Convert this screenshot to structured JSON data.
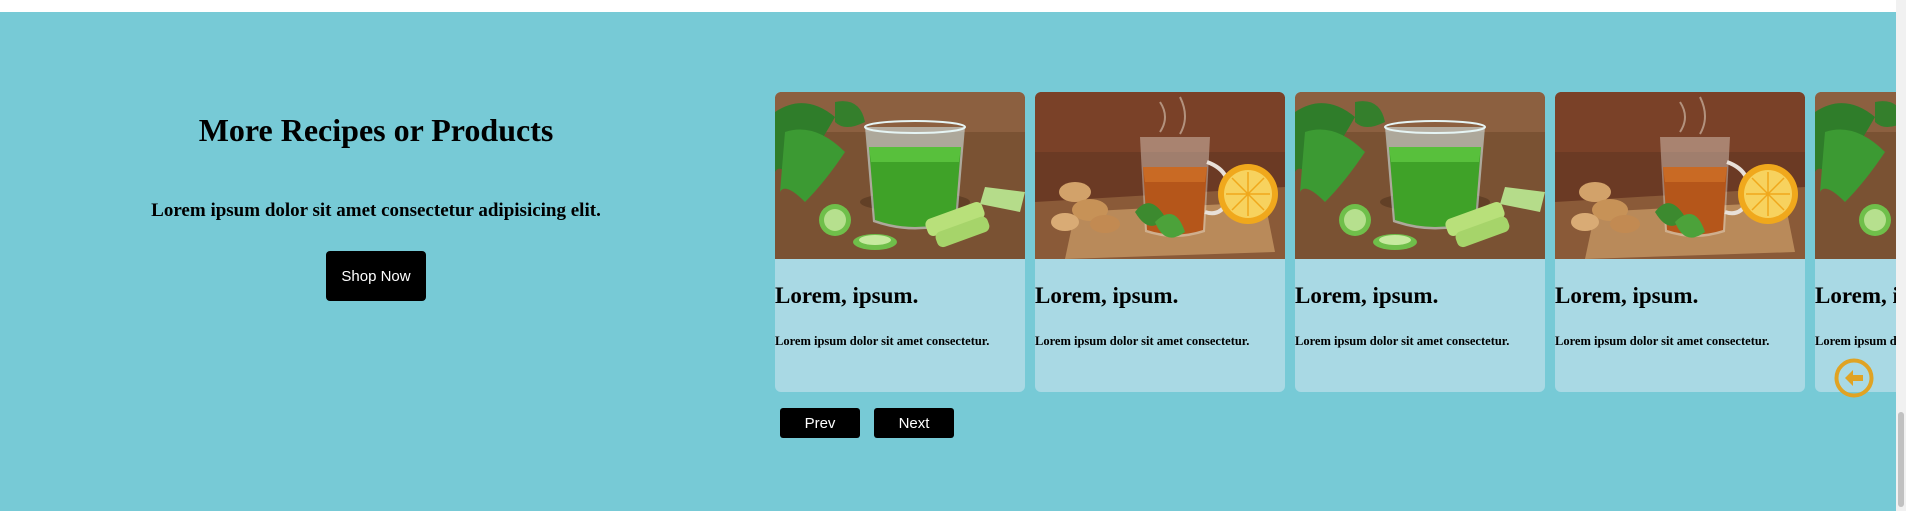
{
  "intro": {
    "title": "More Recipes or Products",
    "subtitle": "Lorem ipsum dolor sit amet consectetur adipisicing elit.",
    "button_label": "Shop Now"
  },
  "cards": [
    {
      "title": "Lorem, ipsum.",
      "text": "Lorem ipsum dolor sit amet consectetur.",
      "image": "green-smoothie"
    },
    {
      "title": "Lorem, ipsum.",
      "text": "Lorem ipsum dolor sit amet consectetur.",
      "image": "ginger-tea"
    },
    {
      "title": "Lorem, ipsum.",
      "text": "Lorem ipsum dolor sit amet consectetur.",
      "image": "green-smoothie"
    },
    {
      "title": "Lorem, ipsum.",
      "text": "Lorem ipsum dolor sit amet consectetur.",
      "image": "ginger-tea"
    },
    {
      "title": "Lorem, ipsum.",
      "text": "Lorem ipsum dolor sit amet consectetur.",
      "image": "green-smoothie"
    }
  ],
  "controls": {
    "prev_label": "Prev",
    "next_label": "Next"
  },
  "icons": {
    "back": "arrow-left-circle-icon"
  },
  "colors": {
    "section_bg": "#77cad6",
    "card_bg": "#a9d9e4",
    "button_bg": "#000000",
    "icon_accent": "#e0a323"
  }
}
